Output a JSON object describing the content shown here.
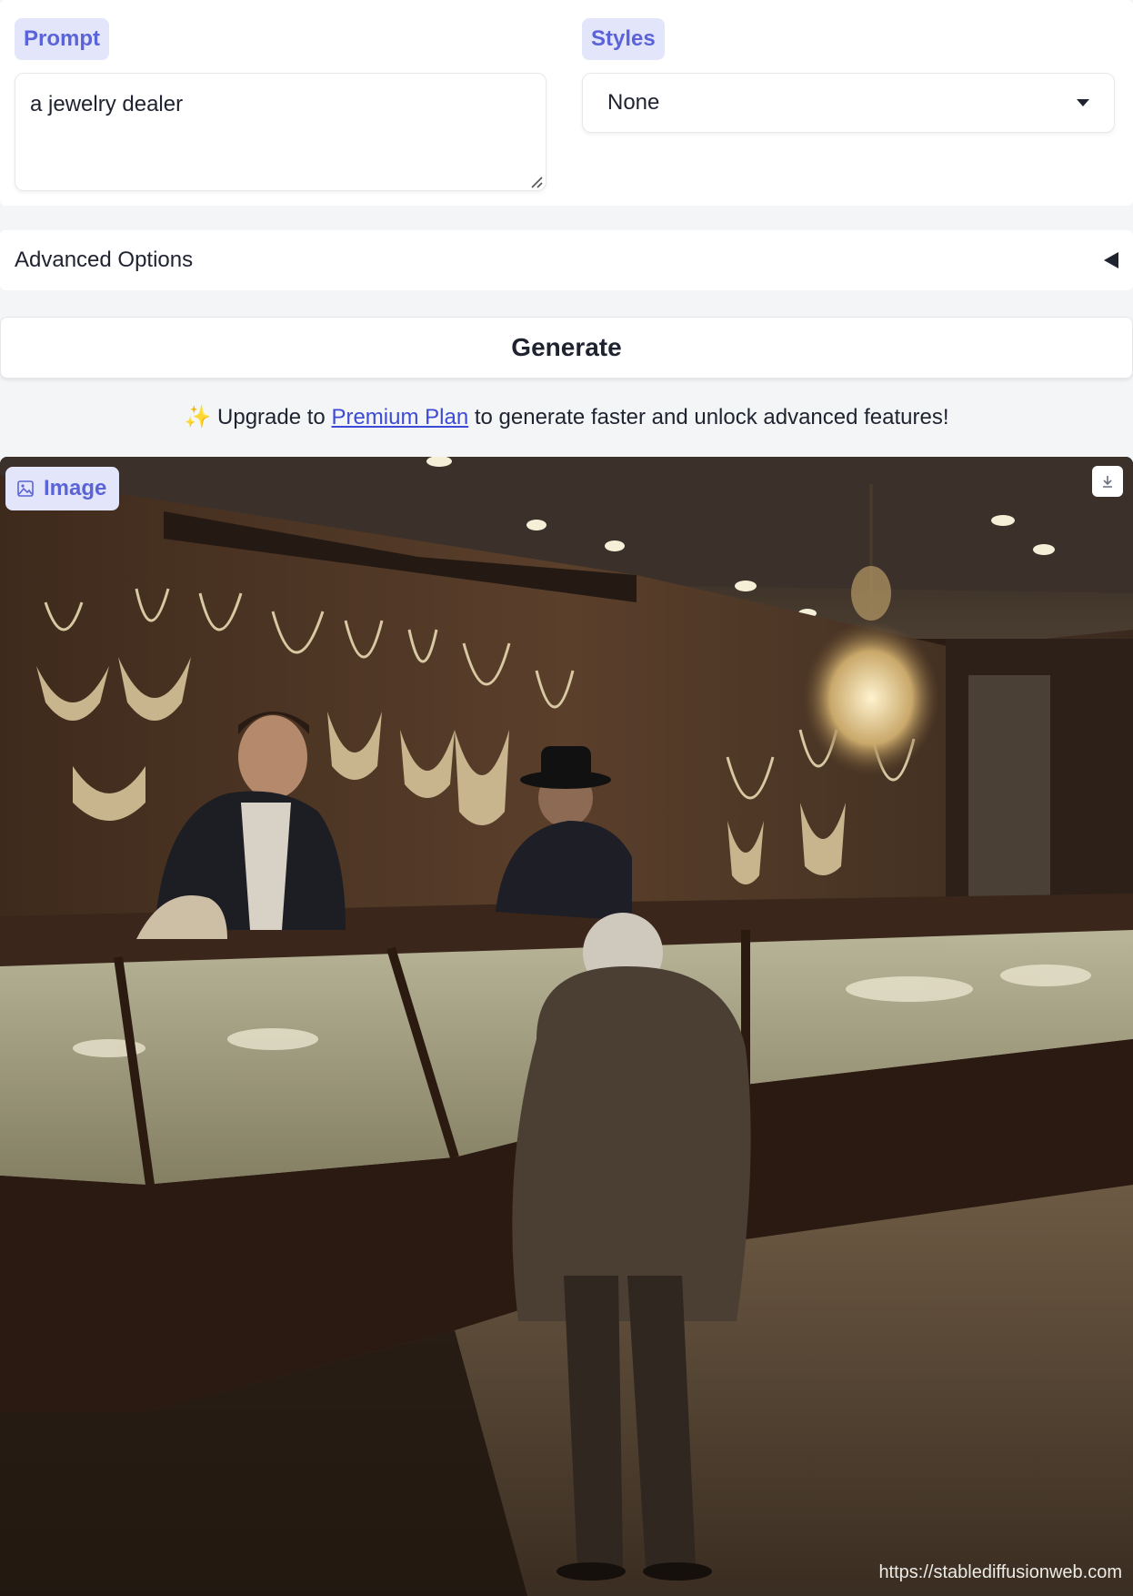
{
  "prompt": {
    "label": "Prompt",
    "value": "a jewelry dealer"
  },
  "styles": {
    "label": "Styles",
    "selected": "None"
  },
  "advanced": {
    "label": "Advanced Options"
  },
  "generate": {
    "label": "Generate"
  },
  "upgrade": {
    "sparkle": "✨",
    "prefix": "Upgrade to",
    "link": "Premium Plan",
    "suffix": "to generate faster and unlock advanced features!"
  },
  "output": {
    "label": "Image",
    "watermark": "https://stablediffusionweb.com"
  },
  "colors": {
    "accent": "#5b63d8",
    "label_bg": "#e3e6fb",
    "link": "#3c4ad6"
  }
}
